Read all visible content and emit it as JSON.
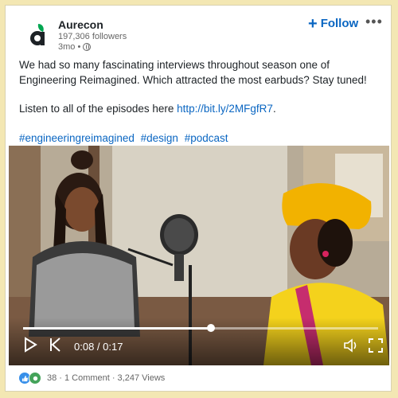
{
  "post": {
    "author": "Aurecon",
    "followers": "197,306 followers",
    "time": "3mo •",
    "follow_label": "Follow",
    "more_label": "•••",
    "text_line1": "We had so many fascinating interviews throughout season one of Engineering Reimagined. Which attracted the most earbuds? Stay tuned!",
    "text_line2_prefix": "Listen to all of the episodes here ",
    "link": "http://bit.ly/2MFgfR7",
    "text_line2_suffix": ".",
    "hashtags": [
      "#engineeringreimagined",
      "#design",
      "#podcast"
    ]
  },
  "video": {
    "current_time": "0:08",
    "separator": " / ",
    "duration": "0:17",
    "progress": 0.53
  },
  "footer": {
    "reactions": "38",
    "comments": "· 1 Comment",
    "views": "· 3,247 Views"
  },
  "colors": {
    "accent": "#0a66c2",
    "brand_green": "#00a651"
  },
  "icons": [
    "aurecon-logo-icon",
    "globe-icon",
    "plus-icon",
    "more-icon",
    "play-icon",
    "replay-icon",
    "volume-icon",
    "fullscreen-icon",
    "like-reaction-icon",
    "support-reaction-icon"
  ]
}
